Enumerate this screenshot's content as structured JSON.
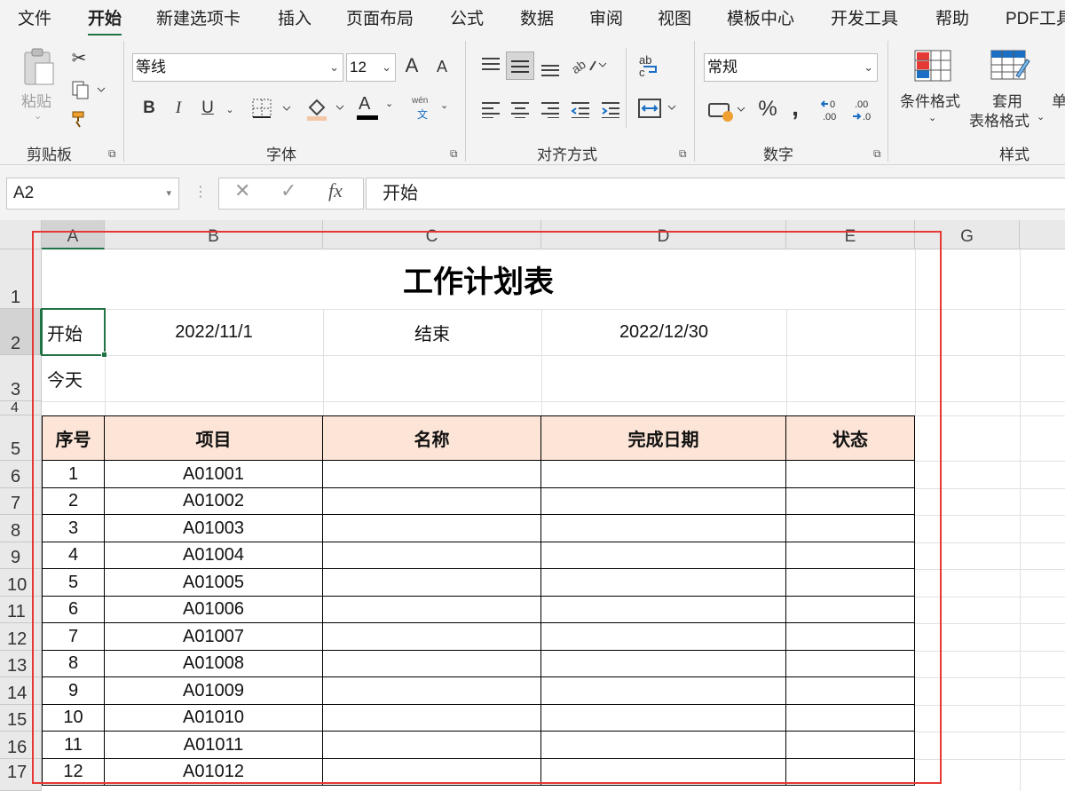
{
  "ribbon_tabs": [
    "文件",
    "开始",
    "新建选项卡",
    "插入",
    "页面布局",
    "公式",
    "数据",
    "审阅",
    "视图",
    "模板中心",
    "开发工具",
    "帮助",
    "PDF工具"
  ],
  "active_tab": "开始",
  "clipboard": {
    "paste_label": "粘贴",
    "group_label": "剪贴板"
  },
  "font": {
    "family": "等线",
    "size": "12",
    "group_label": "字体",
    "bold": "B",
    "italic": "I",
    "underline": "U",
    "phonetic_top": "wén",
    "phonetic_bottom": "文",
    "grow": "A",
    "shrink": "A",
    "font_color": "A"
  },
  "alignment": {
    "group_label": "对齐方式"
  },
  "number": {
    "format": "常规",
    "group_label": "数字",
    "percent": "%",
    "comma": ","
  },
  "styles": {
    "conditional_label": "条件格式",
    "table_label_1": "套用",
    "table_label_2": "表格格式",
    "cell_style_partial": "单",
    "group_label": "样式"
  },
  "formula_bar": {
    "name_box": "A2",
    "cancel": "✕",
    "enter": "✓",
    "fx": "fx",
    "content": "开始"
  },
  "columns": [
    "A",
    "B",
    "C",
    "D",
    "E",
    "G"
  ],
  "rows": [
    "1",
    "2",
    "3",
    "4",
    "5",
    "6",
    "7",
    "8",
    "9",
    "10",
    "11",
    "12",
    "13",
    "14",
    "15",
    "16",
    "17"
  ],
  "sheet": {
    "title": "工作计划表",
    "start_label": "开始",
    "start_date": "2022/11/1",
    "end_label": "结束",
    "end_date": "2022/12/30",
    "today_label": "今天",
    "headers": [
      "序号",
      "项目",
      "名称",
      "完成日期",
      "状态"
    ],
    "data": [
      [
        "1",
        "A01001"
      ],
      [
        "2",
        "A01002"
      ],
      [
        "3",
        "A01003"
      ],
      [
        "4",
        "A01004"
      ],
      [
        "5",
        "A01005"
      ],
      [
        "6",
        "A01006"
      ],
      [
        "7",
        "A01007"
      ],
      [
        "8",
        "A01008"
      ],
      [
        "9",
        "A01009"
      ],
      [
        "10",
        "A01010"
      ],
      [
        "11",
        "A01011"
      ],
      [
        "12",
        "A01012"
      ]
    ]
  },
  "colors": {
    "accent": "#217346",
    "header_fill": "#fce4d6",
    "highlight_box": "#e53935"
  }
}
